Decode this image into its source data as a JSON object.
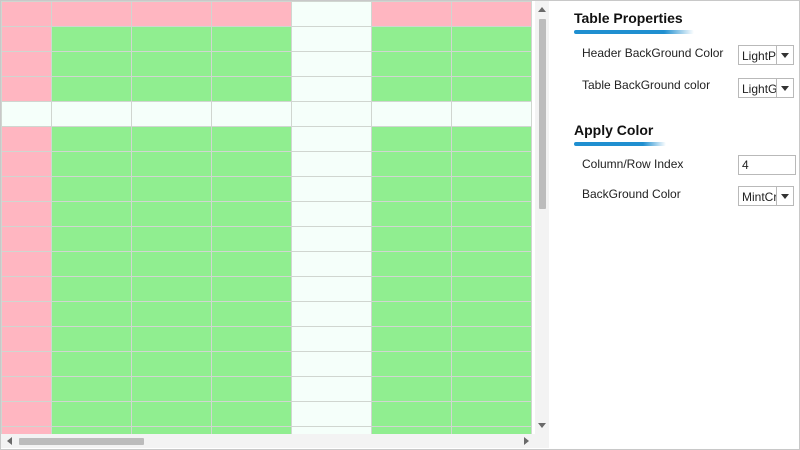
{
  "colors": {
    "header_background": "#FFB6C1",
    "table_background": "#90EE90",
    "highlight_background": "#F5FFFA",
    "grid_line": "#D0D6D0",
    "accent": "#1F8FD0"
  },
  "grid": {
    "columns": 7,
    "rows": 18,
    "highlight_index": 4
  },
  "panel": {
    "table_properties": {
      "title": "Table Properties",
      "header_bg_label": "Header BackGround Color",
      "header_bg_value": "LightPink",
      "table_bg_label": "Table BackGround color",
      "table_bg_value": "LightGreen"
    },
    "apply_color": {
      "title": "Apply Color",
      "index_label": "Column/Row Index",
      "index_value": "4",
      "bg_label": "BackGround Color",
      "bg_value": "MintCream"
    }
  },
  "icons": {
    "scroll_up": "arrow-up-icon",
    "scroll_down": "arrow-down-icon",
    "scroll_left": "arrow-left-icon",
    "scroll_right": "arrow-right-icon",
    "dropdown": "chevron-down-icon"
  }
}
